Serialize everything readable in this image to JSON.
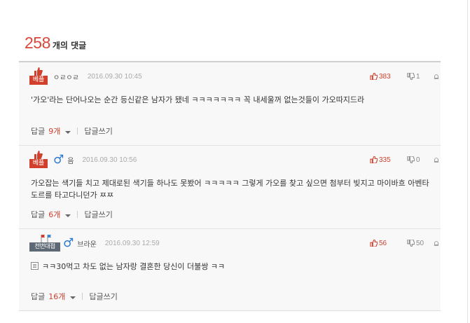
{
  "header": {
    "count": "258",
    "label": "개의 댓글"
  },
  "badges": {
    "best": "베플",
    "champion": "천번대접"
  },
  "actions": {
    "reply_label": "답글",
    "write_label": "답글쓰기"
  },
  "comments": [
    {
      "nick": "ㅇㄹㅇㄹ",
      "date": "2016.09.30 10:45",
      "badge": "best",
      "gender": "",
      "text": "'가오'라는 단어나오는 순간 등신같은 남자가 됐네 ㅋㅋㅋㅋㅋㅋㅋ 꼭 내세울꺼 없는것들이 가오따지드라",
      "up": "383",
      "down": "1",
      "replies": "9개"
    },
    {
      "nick": "음",
      "date": "2016.09.30 10:56",
      "badge": "best",
      "gender": "♂",
      "text": "가오잡는 색기들 치고 제대로된 색기들 하나도 못봤어 ㅋㅋㅋㅋㅋ 그렇게 가오를 찾고 싶으면 첨부터 빚지고 마이바흐 아벤타도르를 타고다니던가 ㅉㅉ",
      "up": "335",
      "down": "0",
      "replies": "6개"
    },
    {
      "nick": "브라운",
      "date": "2016.09.30 12:59",
      "badge": "champion",
      "gender": "♂",
      "text": "ㅋㅋ30먹고 차도 없는 남자랑 결혼한 당신이 더불쌍 ㅋㅋ",
      "up": "56",
      "down": "50",
      "replies": "16개"
    }
  ],
  "colors": {
    "accent": "#d9463a",
    "male": "#2b78d0",
    "best_badge": "#d0402d",
    "champion_badge": "#5d6975"
  }
}
